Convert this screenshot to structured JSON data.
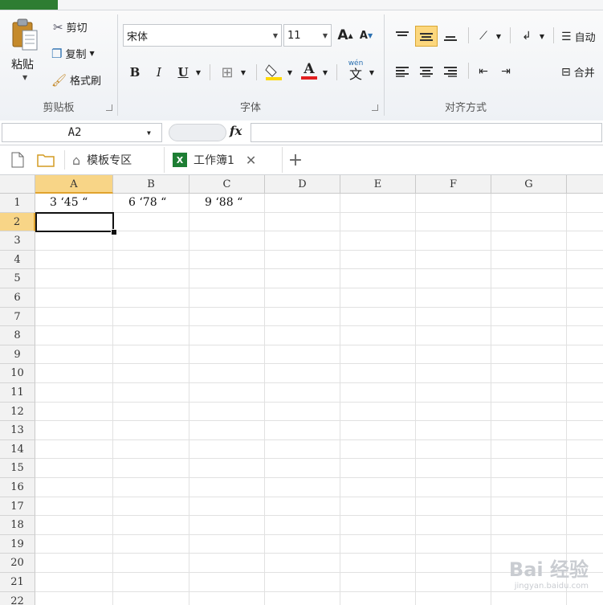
{
  "ribbon": {
    "clipboard": {
      "paste": "粘贴",
      "cut": "剪切",
      "copy": "复制",
      "format_painter": "格式刷",
      "group_label": "剪贴板"
    },
    "font": {
      "name": "宋体",
      "size": "11",
      "group_label": "字体",
      "bold": "B",
      "italic": "I",
      "underline": "U",
      "grow": "A",
      "shrink": "A",
      "phonetic": "wén"
    },
    "alignment": {
      "wrap_label": "自动",
      "merge_label": "合并",
      "group_label": "对齐方式"
    }
  },
  "formula_bar": {
    "name_box": "A2",
    "fx": "fx",
    "content": ""
  },
  "tabs": [
    {
      "label": "模板专区"
    },
    {
      "label": "工作簿1"
    }
  ],
  "sheet": {
    "columns": [
      "A",
      "B",
      "C",
      "D",
      "E",
      "F",
      "G",
      ""
    ],
    "rows": [
      "1",
      "2",
      "3",
      "4",
      "5",
      "6",
      "7",
      "8",
      "9",
      "10",
      "11",
      "12",
      "13",
      "14",
      "15",
      "16",
      "17",
      "18",
      "19",
      "20",
      "21",
      "22"
    ],
    "cells": {
      "A1": "3 ‘45 “",
      "B1": "6 ‘78 “",
      "C1": "9 ‘88 “"
    },
    "active_cell": "A2"
  },
  "watermark": {
    "logo": "Bai 经验",
    "url": "jingyan.baidu.com"
  },
  "colors": {
    "accent": "#f8d587",
    "excel_green": "#2e7d32"
  }
}
